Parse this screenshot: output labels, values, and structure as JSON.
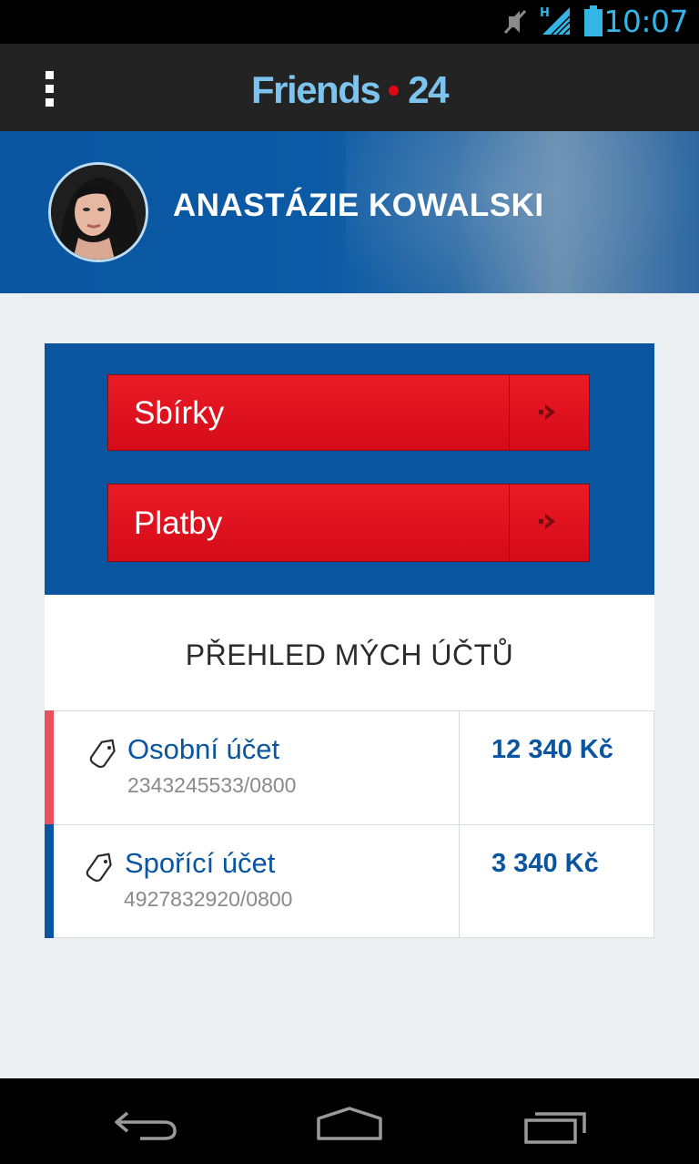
{
  "status_bar": {
    "time": "10:07",
    "network_label": "H",
    "icons": [
      "mute-icon",
      "signal-icon",
      "battery-icon"
    ],
    "color": "#33b5e5"
  },
  "action_bar": {
    "app_name_left": "Friends",
    "app_name_right": "24",
    "menu_icon": "overflow-menu-icon"
  },
  "profile": {
    "name": "ANASTÁZIE KOWALSKI",
    "avatar": "avatar-photo"
  },
  "actions": [
    {
      "label": "Sbírky",
      "icon": "arrow-right-icon"
    },
    {
      "label": "Platby",
      "icon": "arrow-right-icon"
    }
  ],
  "overview": {
    "title": "PŘEHLED MÝCH ÚČTŮ"
  },
  "accounts": [
    {
      "name": "Osobní účet",
      "number": "2343245533/0800",
      "balance": "12 340 Kč",
      "stripe_color": "#e8505b",
      "icon": "tag-icon"
    },
    {
      "name": "Spořící účet",
      "number": "4927832920/0800",
      "balance": "3 340 Kč",
      "stripe_color": "#0a55a0",
      "icon": "tag-icon"
    }
  ],
  "nav_bar": {
    "icons": [
      "back-icon",
      "home-icon",
      "recent-apps-icon"
    ]
  },
  "colors": {
    "brand_blue": "#0a55a0",
    "brand_red": "#e30613",
    "title_blue": "#7cc4ee"
  }
}
